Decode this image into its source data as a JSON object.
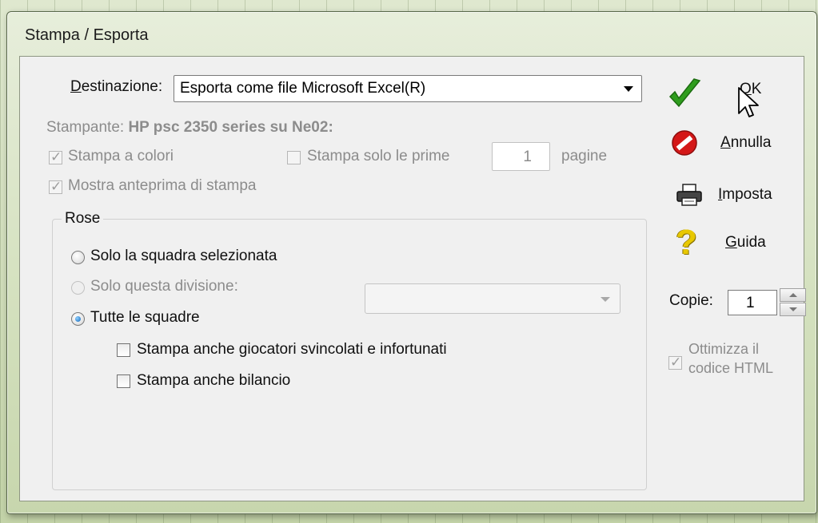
{
  "window": {
    "title": "Stampa / Esporta"
  },
  "destination": {
    "label_prefix": "",
    "label_underlined": "D",
    "label_rest": "estinazione:",
    "value": "Esporta come file Microsoft Excel(R)"
  },
  "printer": {
    "label": "Stampante:",
    "name": "HP psc 2350 series su Ne02:"
  },
  "options": {
    "color_print": {
      "label": "Stampa a colori",
      "checked": true,
      "disabled": true
    },
    "first_pages": {
      "label": "Stampa solo le prime",
      "checked": false,
      "disabled": true,
      "value": "1",
      "suffix": "pagine"
    },
    "preview": {
      "label": "Mostra anteprima di stampa",
      "checked": true,
      "disabled": true
    }
  },
  "rose": {
    "title": "Rose",
    "radio_selected_team": "Solo la squadra selezionata",
    "radio_division": "Solo questa divisione:",
    "radio_all": "Tutte le squadre",
    "selected": "all",
    "chk_free_injured": "Stampa anche giocatori svincolati e infortunati",
    "chk_budget": "Stampa anche bilancio"
  },
  "buttons": {
    "ok": {
      "underlined": "O",
      "rest": "K"
    },
    "cancel": {
      "underlined": "A",
      "rest": "nnulla"
    },
    "setup": {
      "underlined": "I",
      "rest": "mposta"
    },
    "help": {
      "underlined": "G",
      "rest": "uida"
    }
  },
  "copies": {
    "label": "Copie:",
    "value": "1"
  },
  "html_opt": {
    "line1": "Ottimizza il",
    "line2": "codice HTML",
    "checked": true,
    "disabled": true
  },
  "colors": {
    "ok_green": "#2f9d1e",
    "cancel_red": "#d41818",
    "help_yellow": "#e8c800",
    "radio_blue": "#1565b8"
  }
}
